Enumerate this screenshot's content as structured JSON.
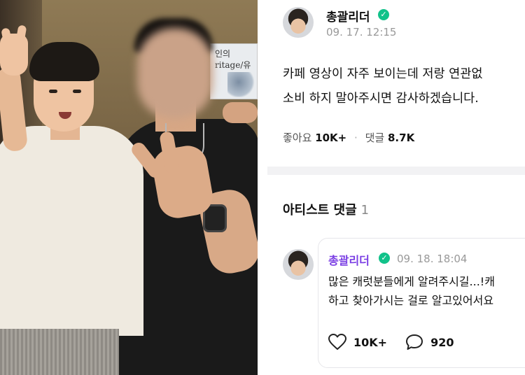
{
  "photo": {
    "poster_text_line1": "인의",
    "poster_text_line2": "ritage/유"
  },
  "post": {
    "author": "총괄리더",
    "timestamp": "09. 17. 12:15",
    "body_line1": "카페 영상이 자주 보이는데 저랑 연관없",
    "body_line2": "소비 하지 말아주시면 감사하겠습니다.",
    "likes_label": "좋아요",
    "likes_count": "10K+",
    "comments_label": "댓글",
    "comments_count": "8.7K"
  },
  "artist_comments": {
    "title": "아티스트 댓글",
    "count": "1"
  },
  "comment": {
    "author": "총괄리더",
    "timestamp": "09. 18. 18:04",
    "text_line1": "많은 캐럿분들에게 알려주시길...!캐",
    "text_line2": "하고 찾아가시는 걸로 알고있어서요",
    "like_count": "10K+",
    "reply_count": "920"
  },
  "colors": {
    "verified": "#11c28a",
    "comment_author": "#7b3fe4",
    "muted": "#999999"
  },
  "icons": {
    "verified": "verified-badge-icon",
    "like": "heart-icon",
    "reply": "speech-bubble-icon"
  }
}
